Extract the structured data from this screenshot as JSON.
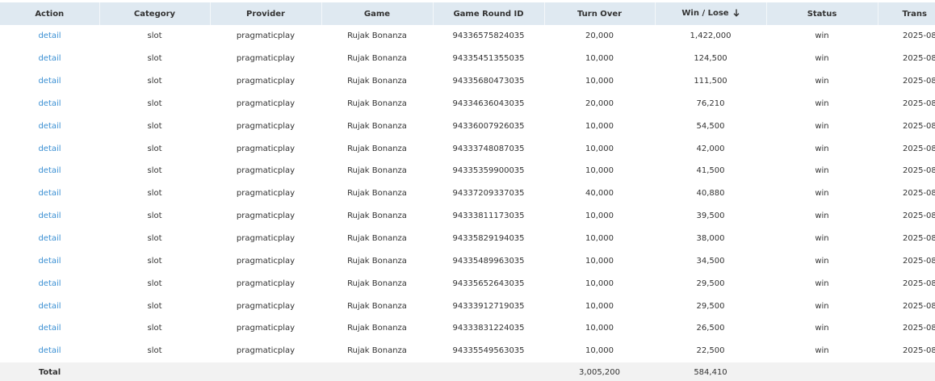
{
  "table": {
    "headers": {
      "action": "Action",
      "category": "Category",
      "provider": "Provider",
      "game": "Game",
      "round_id": "Game Round ID",
      "turn_over": "Turn Over",
      "win_lose": "Win / Lose",
      "status": "Status",
      "trans": "Trans"
    },
    "sort": {
      "column": "win_lose",
      "direction": "descending",
      "icon": "arrow-down-icon"
    },
    "rows": [
      {
        "action": "detail",
        "category": "slot",
        "provider": "pragmaticplay",
        "game": "Rujak Bonanza",
        "round_id": "94336575824035",
        "turn_over": "20,000",
        "win_lose": "1,422,000",
        "status": "win",
        "trans": "2025-08-"
      },
      {
        "action": "detail",
        "category": "slot",
        "provider": "pragmaticplay",
        "game": "Rujak Bonanza",
        "round_id": "94335451355035",
        "turn_over": "10,000",
        "win_lose": "124,500",
        "status": "win",
        "trans": "2025-08-"
      },
      {
        "action": "detail",
        "category": "slot",
        "provider": "pragmaticplay",
        "game": "Rujak Bonanza",
        "round_id": "94335680473035",
        "turn_over": "10,000",
        "win_lose": "111,500",
        "status": "win",
        "trans": "2025-08-"
      },
      {
        "action": "detail",
        "category": "slot",
        "provider": "pragmaticplay",
        "game": "Rujak Bonanza",
        "round_id": "94334636043035",
        "turn_over": "20,000",
        "win_lose": "76,210",
        "status": "win",
        "trans": "2025-08-"
      },
      {
        "action": "detail",
        "category": "slot",
        "provider": "pragmaticplay",
        "game": "Rujak Bonanza",
        "round_id": "94336007926035",
        "turn_over": "10,000",
        "win_lose": "54,500",
        "status": "win",
        "trans": "2025-08-"
      },
      {
        "action": "detail",
        "category": "slot",
        "provider": "pragmaticplay",
        "game": "Rujak Bonanza",
        "round_id": "94333748087035",
        "turn_over": "10,000",
        "win_lose": "42,000",
        "status": "win",
        "trans": "2025-08-"
      },
      {
        "action": "detail",
        "category": "slot",
        "provider": "pragmaticplay",
        "game": "Rujak Bonanza",
        "round_id": "94335359900035",
        "turn_over": "10,000",
        "win_lose": "41,500",
        "status": "win",
        "trans": "2025-08-"
      },
      {
        "action": "detail",
        "category": "slot",
        "provider": "pragmaticplay",
        "game": "Rujak Bonanza",
        "round_id": "94337209337035",
        "turn_over": "40,000",
        "win_lose": "40,880",
        "status": "win",
        "trans": "2025-08-"
      },
      {
        "action": "detail",
        "category": "slot",
        "provider": "pragmaticplay",
        "game": "Rujak Bonanza",
        "round_id": "94333811173035",
        "turn_over": "10,000",
        "win_lose": "39,500",
        "status": "win",
        "trans": "2025-08-"
      },
      {
        "action": "detail",
        "category": "slot",
        "provider": "pragmaticplay",
        "game": "Rujak Bonanza",
        "round_id": "94335829194035",
        "turn_over": "10,000",
        "win_lose": "38,000",
        "status": "win",
        "trans": "2025-08-"
      },
      {
        "action": "detail",
        "category": "slot",
        "provider": "pragmaticplay",
        "game": "Rujak Bonanza",
        "round_id": "94335489963035",
        "turn_over": "10,000",
        "win_lose": "34,500",
        "status": "win",
        "trans": "2025-08-"
      },
      {
        "action": "detail",
        "category": "slot",
        "provider": "pragmaticplay",
        "game": "Rujak Bonanza",
        "round_id": "94335652643035",
        "turn_over": "10,000",
        "win_lose": "29,500",
        "status": "win",
        "trans": "2025-08-"
      },
      {
        "action": "detail",
        "category": "slot",
        "provider": "pragmaticplay",
        "game": "Rujak Bonanza",
        "round_id": "94333912719035",
        "turn_over": "10,000",
        "win_lose": "29,500",
        "status": "win",
        "trans": "2025-08-"
      },
      {
        "action": "detail",
        "category": "slot",
        "provider": "pragmaticplay",
        "game": "Rujak Bonanza",
        "round_id": "94333831224035",
        "turn_over": "10,000",
        "win_lose": "26,500",
        "status": "win",
        "trans": "2025-08-"
      },
      {
        "action": "detail",
        "category": "slot",
        "provider": "pragmaticplay",
        "game": "Rujak Bonanza",
        "round_id": "94335549563035",
        "turn_over": "10,000",
        "win_lose": "22,500",
        "status": "win",
        "trans": "2025-08-"
      }
    ],
    "total": {
      "label": "Total",
      "turn_over": "3,005,200",
      "win_lose": "584,410"
    }
  },
  "colors": {
    "header_bg": "#dfe9f1",
    "link": "#3a8fd3",
    "footer_bg": "#f2f2f2",
    "text": "#333333"
  }
}
